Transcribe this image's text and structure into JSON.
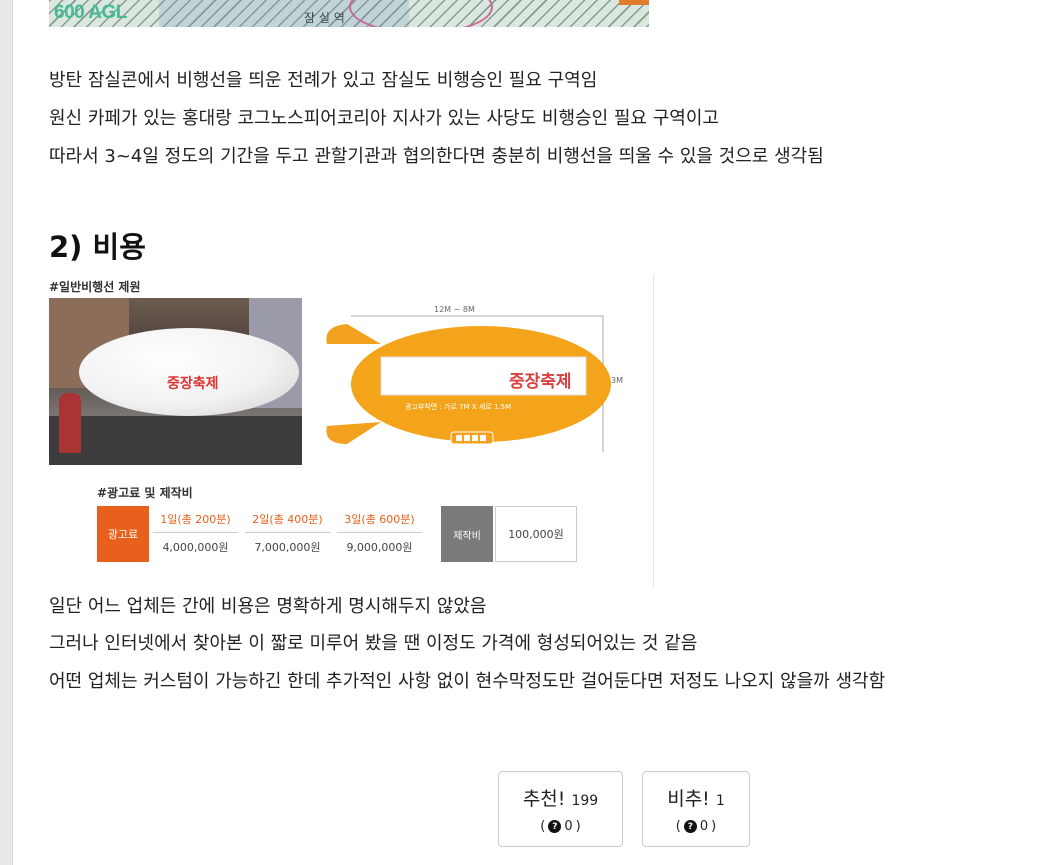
{
  "map_image": {
    "label": "600 AGL",
    "partial_caption": "잠 실 역"
  },
  "paragraphs_top": [
    "방탄 잠실콘에서 비행선을 띄운 전례가 있고 잠실도 비행승인 필요 구역임",
    "원신 카페가 있는 홍대랑 코그노스피어코리아 지사가 있는 사당도 비행승인 필요 구역이고",
    "따라서 3~4일 정도의 기간을 두고 관할기관과 협의한다면 충분히 비행선을 띄울 수 있을 것으로 생각됨"
  ],
  "section_title": "2) 비용",
  "infographic": {
    "spec_title": "#일반비행선 제원",
    "banner_text": "중장축제",
    "banner_text2": "중장축제",
    "dim_length": "12M ~ 8M",
    "dim_height": "3M",
    "ad_size": "광고부착면 : 가로 7M X 세로 1.5M",
    "fee_title": "#광고료 및 제작비",
    "fee_label": "광고료",
    "fees": [
      {
        "period": "1일(총 200분)",
        "price": "4,000,000원"
      },
      {
        "period": "2일(총 400분)",
        "price": "7,000,000원"
      },
      {
        "period": "3일(총 600분)",
        "price": "9,000,000원"
      }
    ],
    "make_label": "제작비",
    "make_price": "100,000원"
  },
  "paragraphs_bottom": [
    "일단 어느 업체든 간에 비용은 명확하게 명시해두지 않았음",
    "그러나 인터넷에서 찾아본 이 짧로 미루어 봤을 땐 이정도 가격에 형성되어있는 것 같음",
    "어떤 업체는 커스텀이 가능하긴 한데 추가적인 사항 없이 현수막정도만 걸어둔다면 저정도 나오지 않을까 생각함"
  ],
  "votes": {
    "up_label": "추천!",
    "up_count": "199",
    "up_sub": "0",
    "down_label": "비추!",
    "down_count": "1",
    "down_sub": "0",
    "help_icon": "question-circle-icon"
  }
}
